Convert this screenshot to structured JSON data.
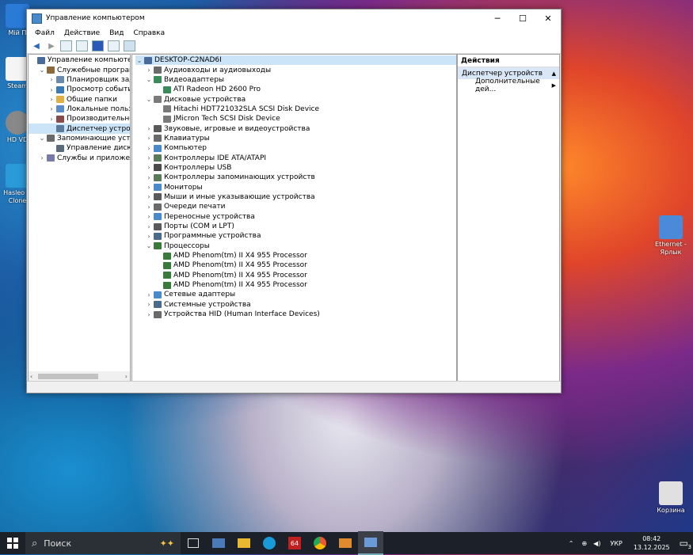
{
  "desktop": {
    "icons_left": [
      {
        "label": "Мій П",
        "color": "#2a7ad8"
      },
      {
        "label": "Steam",
        "color": "#f5f5f5"
      },
      {
        "label": "HD VD",
        "color": "#888888"
      },
      {
        "label": "Hasleo D Clone",
        "color": "#2a9ad8"
      }
    ],
    "icons_right": [
      {
        "label": "Ethernet - Ярлык",
        "color": "#4a8ad8"
      },
      {
        "label": "Корзина",
        "color": "#e0e0e0"
      }
    ]
  },
  "window": {
    "title": "Управление компьютером",
    "menu": [
      "Файл",
      "Действие",
      "Вид",
      "Справка"
    ],
    "left_tree": [
      {
        "label": "Управление компьютером (л",
        "level": 0,
        "exp": "",
        "color": "#4a6a9a"
      },
      {
        "label": "Служебные программы",
        "level": 1,
        "exp": "⌄",
        "color": "#8a6a3a"
      },
      {
        "label": "Планировщик задач",
        "level": 2,
        "exp": "›",
        "color": "#6a8aaa"
      },
      {
        "label": "Просмотр событий",
        "level": 2,
        "exp": "›",
        "color": "#3a7ab8"
      },
      {
        "label": "Общие папки",
        "level": 2,
        "exp": "›",
        "color": "#e0b040"
      },
      {
        "label": "Локальные пользовате",
        "level": 2,
        "exp": "›",
        "color": "#5a8ac8"
      },
      {
        "label": "Производительность",
        "level": 2,
        "exp": "›",
        "color": "#8a4a4a"
      },
      {
        "label": "Диспетчер устройств",
        "level": 2,
        "exp": "",
        "color": "#5a7a9a",
        "selected": true
      },
      {
        "label": "Запоминающие устройст",
        "level": 1,
        "exp": "⌄",
        "color": "#6a6a6a"
      },
      {
        "label": "Управление дисками",
        "level": 2,
        "exp": "",
        "color": "#5a6a7a"
      },
      {
        "label": "Службы и приложения",
        "level": 1,
        "exp": "›",
        "color": "#7a7aaa"
      }
    ],
    "device_tree": [
      {
        "label": "DESKTOP-C2NAD6I",
        "level": 0,
        "exp": "⌄",
        "color": "#4a6a9a",
        "selected": true
      },
      {
        "label": "Аудиовходы и аудиовыходы",
        "level": 1,
        "exp": "›",
        "color": "#6a6a6a"
      },
      {
        "label": "Видеоадаптеры",
        "level": 1,
        "exp": "⌄",
        "color": "#3a8a5a"
      },
      {
        "label": "ATI Radeon HD 2600 Pro",
        "level": 2,
        "exp": "",
        "color": "#3a8a5a"
      },
      {
        "label": "Дисковые устройства",
        "level": 1,
        "exp": "⌄",
        "color": "#7a7a7a"
      },
      {
        "label": "Hitachi HDT721032SLA SCSI Disk Device",
        "level": 2,
        "exp": "",
        "color": "#7a7a7a"
      },
      {
        "label": "JMicron Tech SCSI Disk Device",
        "level": 2,
        "exp": "",
        "color": "#7a7a7a"
      },
      {
        "label": "Звуковые, игровые и видеоустройства",
        "level": 1,
        "exp": "›",
        "color": "#5a5a5a"
      },
      {
        "label": "Клавиатуры",
        "level": 1,
        "exp": "›",
        "color": "#6a6a6a"
      },
      {
        "label": "Компьютер",
        "level": 1,
        "exp": "›",
        "color": "#4a8ac8"
      },
      {
        "label": "Контроллеры IDE ATA/ATAPI",
        "level": 1,
        "exp": "›",
        "color": "#5a7a5a"
      },
      {
        "label": "Контроллеры USB",
        "level": 1,
        "exp": "›",
        "color": "#4a4a4a"
      },
      {
        "label": "Контроллеры запоминающих устройств",
        "level": 1,
        "exp": "›",
        "color": "#5a7a5a"
      },
      {
        "label": "Мониторы",
        "level": 1,
        "exp": "›",
        "color": "#4a8ac8"
      },
      {
        "label": "Мыши и иные указывающие устройства",
        "level": 1,
        "exp": "›",
        "color": "#5a5a5a"
      },
      {
        "label": "Очереди печати",
        "level": 1,
        "exp": "›",
        "color": "#6a6a6a"
      },
      {
        "label": "Переносные устройства",
        "level": 1,
        "exp": "›",
        "color": "#4a8ac8"
      },
      {
        "label": "Порты (COM и LPT)",
        "level": 1,
        "exp": "›",
        "color": "#5a5a5a"
      },
      {
        "label": "Программные устройства",
        "level": 1,
        "exp": "›",
        "color": "#4a6a8a"
      },
      {
        "label": "Процессоры",
        "level": 1,
        "exp": "⌄",
        "color": "#3a7a3a"
      },
      {
        "label": "AMD Phenom(tm) II X4 955 Processor",
        "level": 2,
        "exp": "",
        "color": "#3a7a3a"
      },
      {
        "label": "AMD Phenom(tm) II X4 955 Processor",
        "level": 2,
        "exp": "",
        "color": "#3a7a3a"
      },
      {
        "label": "AMD Phenom(tm) II X4 955 Processor",
        "level": 2,
        "exp": "",
        "color": "#3a7a3a"
      },
      {
        "label": "AMD Phenom(tm) II X4 955 Processor",
        "level": 2,
        "exp": "",
        "color": "#3a7a3a"
      },
      {
        "label": "Сетевые адаптеры",
        "level": 1,
        "exp": "›",
        "color": "#4a8ac8"
      },
      {
        "label": "Системные устройства",
        "level": 1,
        "exp": "›",
        "color": "#4a6a8a"
      },
      {
        "label": "Устройства HID (Human Interface Devices)",
        "level": 1,
        "exp": "›",
        "color": "#6a6a6a"
      }
    ],
    "actions": {
      "header": "Действия",
      "section": "Диспетчер устройств",
      "more": "Дополнительные дей..."
    }
  },
  "taskbar": {
    "search_label": "Поиск",
    "lang": "УКР",
    "time": "08:42",
    "date": "13.12.2025",
    "notif_count": "3"
  }
}
